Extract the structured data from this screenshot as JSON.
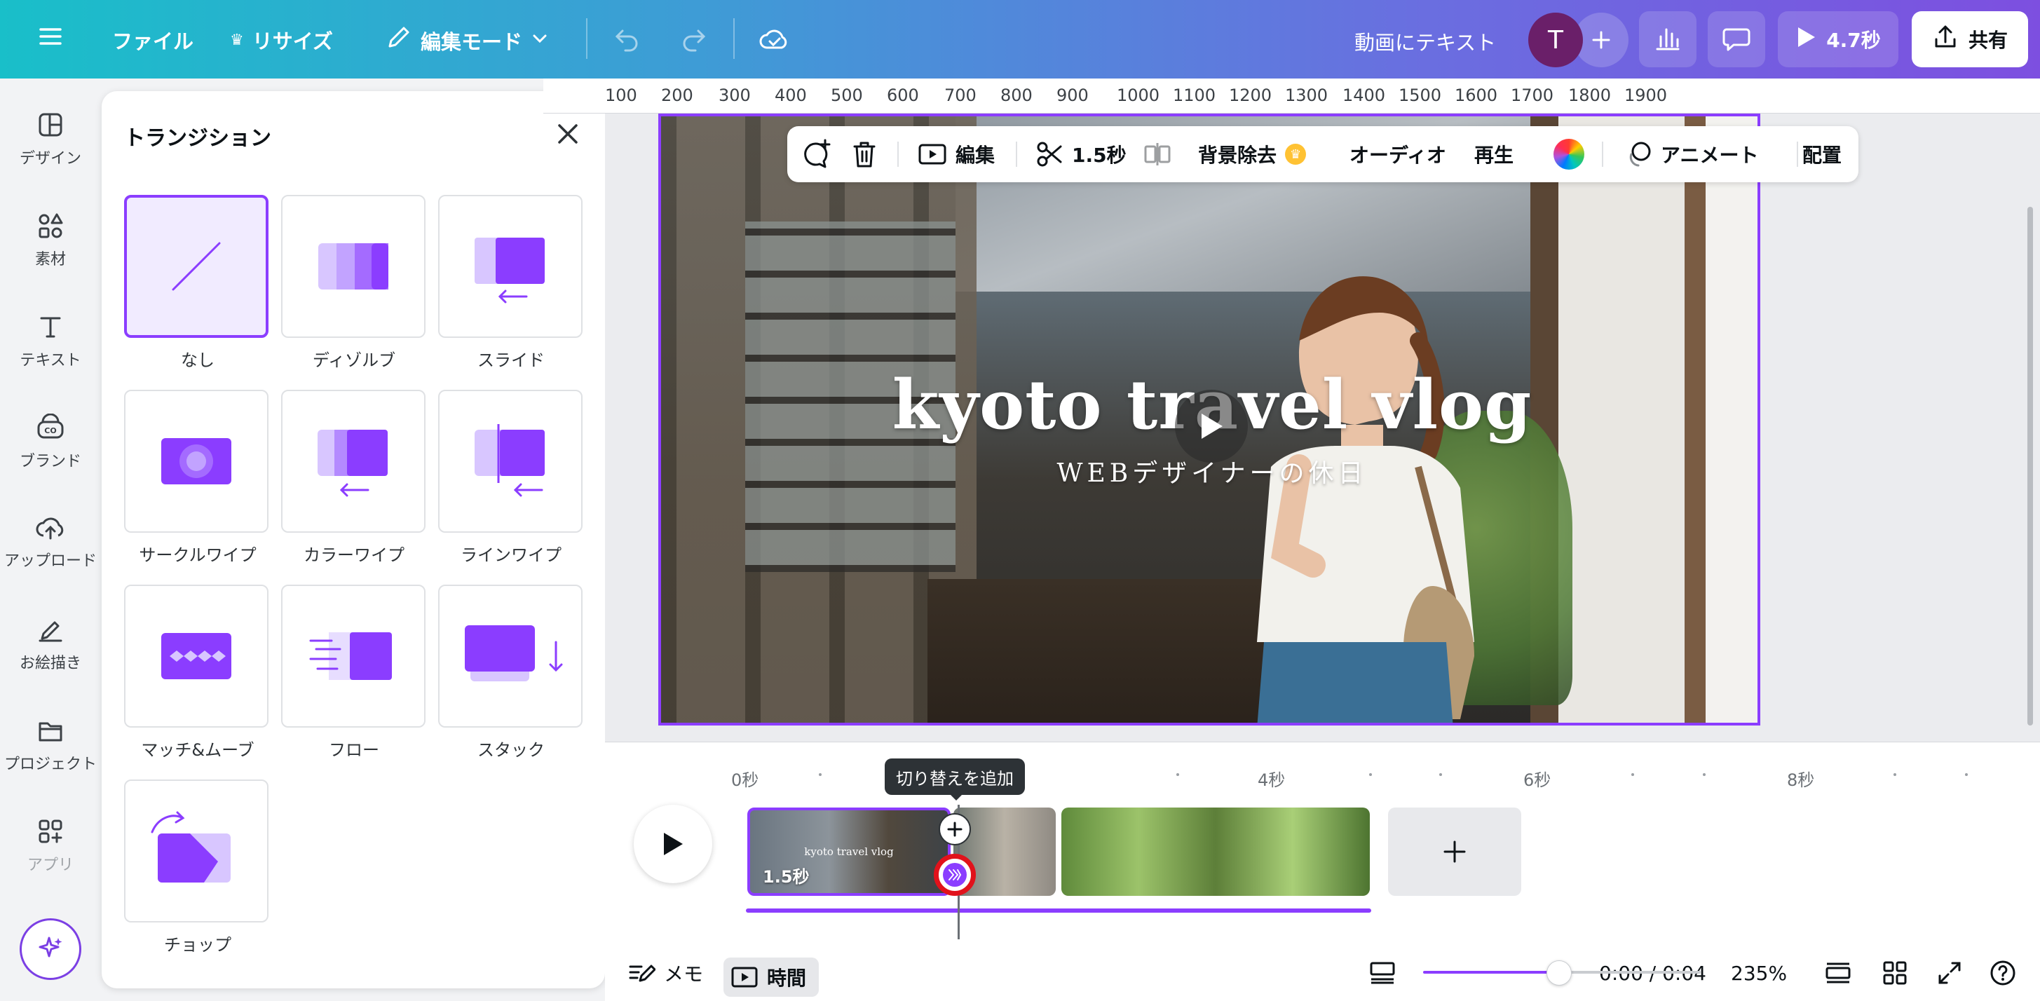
{
  "topbar": {
    "file_label": "ファイル",
    "resize_label": "リサイズ",
    "edit_mode_label": "編集モード",
    "doc_title": "動画にテキスト",
    "avatar_initial": "T",
    "play_duration": "4.7秒",
    "share_label": "共有"
  },
  "sidebar": {
    "items": [
      {
        "label": "デザイン",
        "icon": "layout-icon"
      },
      {
        "label": "素材",
        "icon": "elements-icon"
      },
      {
        "label": "テキスト",
        "icon": "text-icon"
      },
      {
        "label": "ブランド",
        "icon": "brand-icon"
      },
      {
        "label": "アップロード",
        "icon": "upload-icon"
      },
      {
        "label": "お絵描き",
        "icon": "draw-icon"
      },
      {
        "label": "プロジェクト",
        "icon": "folder-icon"
      },
      {
        "label": "アプリ",
        "icon": "apps-icon"
      }
    ]
  },
  "panel": {
    "title": "トランジション",
    "transitions": [
      {
        "label": "なし",
        "selected": true
      },
      {
        "label": "ディゾルブ",
        "selected": false
      },
      {
        "label": "スライド",
        "selected": false
      },
      {
        "label": "サークルワイプ",
        "selected": false
      },
      {
        "label": "カラーワイプ",
        "selected": false
      },
      {
        "label": "ラインワイプ",
        "selected": false
      },
      {
        "label": "マッチ&ムーブ",
        "selected": false
      },
      {
        "label": "フロー",
        "selected": false
      },
      {
        "label": "スタック",
        "selected": false
      },
      {
        "label": "チョップ",
        "selected": false
      }
    ]
  },
  "ruler": {
    "labels": [
      "100",
      "200",
      "300",
      "400",
      "500",
      "600",
      "700",
      "800",
      "900",
      "1000",
      "1100",
      "1200",
      "1300",
      "1400",
      "1500",
      "1600",
      "1700",
      "1800",
      "1900"
    ]
  },
  "context_toolbar": {
    "edit_label": "編集",
    "duration_label": "1.5秒",
    "bg_remove_label": "背景除去",
    "audio_label": "オーディオ",
    "playback_label": "再生",
    "animate_label": "アニメート",
    "arrange_label": "配置"
  },
  "video": {
    "title": "kyoto travel vlog",
    "subtitle": "WEBデザイナーの休日"
  },
  "timeline": {
    "time_marks": [
      "0秒",
      "4秒",
      "6秒",
      "8秒"
    ],
    "clip1_duration": "1.5秒",
    "clip1_text": "kyoto travel vlog",
    "tooltip": "切り替えを追加"
  },
  "bottombar": {
    "notes_label": "メモ",
    "timer_label": "時間",
    "timecode": "0:00 / 0:04",
    "zoom": "235%",
    "zoom_fraction": 0.49
  },
  "colors": {
    "accent": "#8b3dff",
    "transition_button_ring": "#e1121b"
  }
}
